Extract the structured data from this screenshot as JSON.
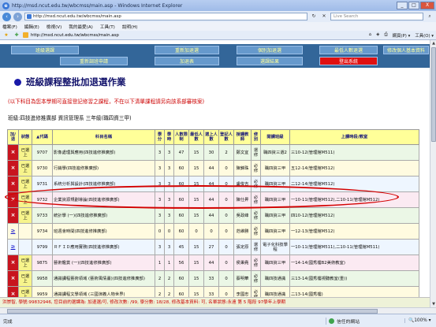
{
  "window": {
    "title": "http://msd.ncut.edu.tw/wbcmss/main.asp - Windows Internet Explorer",
    "min": "_",
    "max": "□",
    "close": "X"
  },
  "address": {
    "url": "http://msd.ncut.edu.tw/wbcmss/main.asp",
    "search_placeholder": "Live Search"
  },
  "menu": [
    "檔案(F)",
    "編輯(E)",
    "檢視(V)",
    "我的最愛(A)",
    "工具(T)",
    "說明(H)"
  ],
  "command_bar": {
    "url": "http://msd.ncut.edu.tw/wbcmss/main.asp",
    "tools": [
      "網頁(P) ▾",
      "工具(O) ▾"
    ]
  },
  "nav": {
    "row1": [
      "班級選課",
      "重新加退選",
      "個別加退選",
      "最低人數退選",
      "修改個人基本資料"
    ],
    "row2": [
      "重新調班申請",
      "加退表",
      "選課結果",
      "登出系統"
    ]
  },
  "page": {
    "title": "班級課程整批加退選作業",
    "note": "(以下科目為您本學期可直接登記修習之課程，不在以下清單課程請另向該系部審核案)",
    "class_line": "班級:四技進修推廣部 資訊管理系 三年級(職四資三甲)"
  },
  "table": {
    "headers": [
      "加/退",
      "狀態",
      "▲代碼",
      "科目名稱",
      "學分",
      "學時",
      "人數限制",
      "最低人數",
      "選上人數",
      "登記人數",
      "授課教師",
      "修別",
      "開課班級",
      "上課時段/教室"
    ],
    "rows": [
      {
        "act": "×",
        "status": "已選上",
        "code": "9707",
        "name": "影像處理與應用(四技進修推廣部)",
        "credit": "3",
        "hours": "3",
        "limit": "47",
        "min": "15",
        "selected": "30",
        "registered": "2",
        "teacher": "鄭文宜",
        "type": "選修",
        "class": "職四資三選2",
        "time": "三10-12(管理館M511)"
      },
      {
        "act": "×",
        "status": "已選上",
        "code": "9730",
        "name": "行銷學(四技進修推廣部)",
        "credit": "3",
        "hours": "3",
        "limit": "60",
        "min": "15",
        "selected": "44",
        "registered": "0",
        "teacher": "陳錦珠",
        "type": "必修",
        "class": "職四資三甲",
        "time": "五12-14(管理館M512)"
      },
      {
        "act": "×",
        "status": "已選上",
        "code": "9731",
        "name": "系統分析與設計(四技進修推廣部)",
        "credit": "3",
        "hours": "3",
        "limit": "60",
        "min": "15",
        "selected": "44",
        "registered": "0",
        "teacher": "盧俊吉",
        "type": "必修",
        "class": "職四資三甲",
        "time": "二12-14(管理館M512)"
      },
      {
        "act": "×",
        "status": "已選上",
        "code": "9732",
        "name": "企業資源規劃導論(四技進修推廣部)",
        "credit": "3",
        "hours": "3",
        "limit": "60",
        "min": "15",
        "selected": "44",
        "registered": "0",
        "teacher": "陳仕昇",
        "type": "必修",
        "class": "職四資三甲",
        "time": "一10-11(管理館M512),二10-11(管理館M512)"
      },
      {
        "act": "×",
        "status": "已選上",
        "code": "9733",
        "name": "統計學 (一)(四技進修推廣部)",
        "credit": "3",
        "hours": "3",
        "limit": "60",
        "min": "15",
        "selected": "44",
        "registered": "0",
        "teacher": "吳政峰",
        "type": "必修",
        "class": "職四資三甲",
        "time": "四10-12(管理館M512)"
      },
      {
        "act": "≥",
        "status": "",
        "code": "9734",
        "name": "班週會時間(四技進修推廣部)",
        "credit": "0",
        "hours": "0",
        "limit": "60",
        "min": "0",
        "selected": "0",
        "registered": "0",
        "teacher": "范維勝",
        "type": "必修",
        "class": "職四資三甲",
        "time": "一12-13(管理館M512)"
      },
      {
        "act": "≥",
        "status": "",
        "code": "9799",
        "name": "ＲＦＩＤ應用實務(四技進修推廣部)",
        "credit": "3",
        "hours": "3",
        "limit": "45",
        "min": "15",
        "selected": "27",
        "registered": "0",
        "teacher": "張定原",
        "type": "選修",
        "class": "電子化科技學程",
        "time": "一10-11(管理館M511),二10-11(管理館M511)"
      },
      {
        "act": "×",
        "status": "已選上",
        "code": "9875",
        "name": "藝術鑑賞 (一)(四技進修推廣部)",
        "credit": "1",
        "hours": "1",
        "limit": "56",
        "min": "15",
        "selected": "44",
        "registered": "0",
        "teacher": "侯秉堯",
        "type": "必修",
        "class": "職四資三甲",
        "time": "一14-14(國秀樓B2美術教室)"
      },
      {
        "act": "×",
        "status": "已選上",
        "code": "9958",
        "name": "通識課程藝術領域 (藝術風情畫)(四技進修推廣部)",
        "credit": "2",
        "hours": "2",
        "limit": "60",
        "min": "15",
        "selected": "33",
        "registered": "0",
        "teacher": "蔡明華",
        "type": "必修",
        "class": "職四技通識",
        "time": "三13-14(國秀樓視聽教室(重))"
      },
      {
        "act": "×",
        "status": "已選上",
        "code": "9959",
        "name": "通識課程文學領域 (三國演義人物世界)",
        "credit": "2",
        "hours": "2",
        "limit": "60",
        "min": "15",
        "selected": "33",
        "registered": "0",
        "teacher": "李國忠",
        "type": "必修",
        "class": "職四技通識",
        "time": "二13-14(國秀樓)"
      }
    ]
  },
  "status_line": "洪崇智, 學號:99832946, 您目前的選課為: 加退選/可, 修改次數: /99, 學分數: 18/28, 修改基本資料: 可, 名單狀態:永遠  第 5 階段  97學年上學期",
  "ie_status": {
    "done": "完成",
    "zone": "信任的網站",
    "zoom": "🔍100% ▾"
  }
}
